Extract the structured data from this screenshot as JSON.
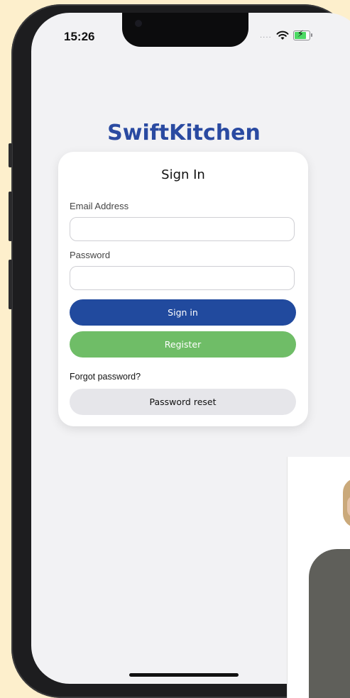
{
  "status_bar": {
    "time": "15:26",
    "signal_dots": "....",
    "wifi_icon": "wifi-icon",
    "battery_icon": "battery-charging-icon"
  },
  "app": {
    "title": "SwiftKitchen"
  },
  "sign_in_card": {
    "title": "Sign In",
    "email_label": "Email Address",
    "email_value": "",
    "password_label": "Password",
    "password_value": "",
    "sign_in_button": "Sign in",
    "register_button": "Register",
    "forgot_password": "Forgot password?",
    "password_reset_button": "Password reset"
  },
  "colors": {
    "brand": "#2a4aa1",
    "sign_in_button": "#214a9e",
    "register_button": "#6fbd67",
    "reset_button": "#e6e6ea",
    "background": "#fdefcc",
    "screen": "#f2f2f4"
  }
}
